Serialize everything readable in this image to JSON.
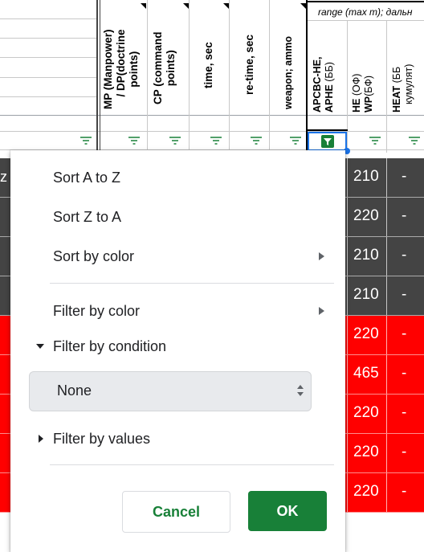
{
  "header": {
    "range_label": "range (max m); дальн",
    "columns": [
      {
        "id": "mp",
        "label_line1": "MP (Manpower)",
        "label_line2": "/ DP(doctrine",
        "label_line3": "points)"
      },
      {
        "id": "cp",
        "label_line1": "CP (command",
        "label_line2": "points)"
      },
      {
        "id": "time",
        "label_line1": "time, sec"
      },
      {
        "id": "retime",
        "label_line1": "re-time, sec"
      },
      {
        "id": "weapon",
        "label_line1": "weapon; ammo"
      },
      {
        "id": "apcbc",
        "label_line1": "APCBC-HE,",
        "label_line2": "APHE",
        "label_suffix": "(ББ)"
      },
      {
        "id": "he",
        "label_line1": "HE",
        "label_line1_suffix": "(ОФ)",
        "label_line2": "WP",
        "label_line2_suffix": "(БФ)"
      },
      {
        "id": "heat",
        "label_line1": "HEAT",
        "label_line1_suffix": "(ББ",
        "label_line2": "кумулят)"
      }
    ]
  },
  "left_cell_fragment": "z",
  "rows": [
    {
      "apcbc": "210",
      "he": "-",
      "color": "#444444"
    },
    {
      "apcbc": "220",
      "he": "-",
      "color": "#444444"
    },
    {
      "apcbc": "210",
      "he": "-",
      "color": "#444444"
    },
    {
      "apcbc": "210",
      "he": "-",
      "color": "#444444"
    },
    {
      "apcbc": "220",
      "he": "-",
      "color": "#ff0000"
    },
    {
      "apcbc": "465",
      "he": "-",
      "color": "#ff0000"
    },
    {
      "apcbc": "220",
      "he": "-",
      "color": "#ff0000"
    },
    {
      "apcbc": "220",
      "he": "-",
      "color": "#ff0000"
    },
    {
      "apcbc": "220",
      "he": "-",
      "color": "#ff0000"
    }
  ],
  "menu": {
    "sort_az": "Sort A to Z",
    "sort_za": "Sort Z to A",
    "sort_color": "Sort by color",
    "filter_color": "Filter by color",
    "filter_condition": "Filter by condition",
    "condition_value": "None",
    "filter_values": "Filter by values",
    "cancel": "Cancel",
    "ok": "OK"
  },
  "colors": {
    "dark_row": "#444444",
    "red_row": "#ff0000",
    "filter_green": "#188038",
    "ok_button": "#188038",
    "active_handle": "#1a73e8"
  }
}
